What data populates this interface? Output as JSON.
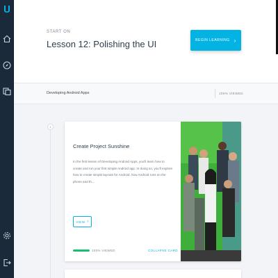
{
  "sidebar": {
    "icons": [
      "udacity-logo-icon",
      "home-icon",
      "compass-icon",
      "catalog-icon",
      "settings-icon",
      "logout-icon"
    ]
  },
  "header": {
    "start_on_label": "START ON",
    "lesson_title": "Lesson 12: Polishing the UI",
    "begin_button_label": "BEGIN LEARNING",
    "begin_button_icon": "chevron-right-icon"
  },
  "breadcrumb": {
    "course": "Developing Android Apps",
    "viewed": "100% VIEWED"
  },
  "timeline": {
    "node_label": "1"
  },
  "card": {
    "title": "Create Project Sunshine",
    "description": "In the first lesson of Developing Android Apps, you'll learn how to create and run your first simple Android app. In doing so, you'll explore how to create simple layouts for Android, how Android runs on the phone and th...",
    "view_label": "VIEW",
    "progress_fraction": 1.0,
    "progress_label": "100% VIEWED",
    "collapse_label": "COLLAPSE CARD",
    "photo": "group-photo-green-screen"
  },
  "colors": {
    "accent": "#02b3e4",
    "sidebar": "#1b2a3a",
    "progress": "#15c26b",
    "title_text": "#2e3d49"
  }
}
